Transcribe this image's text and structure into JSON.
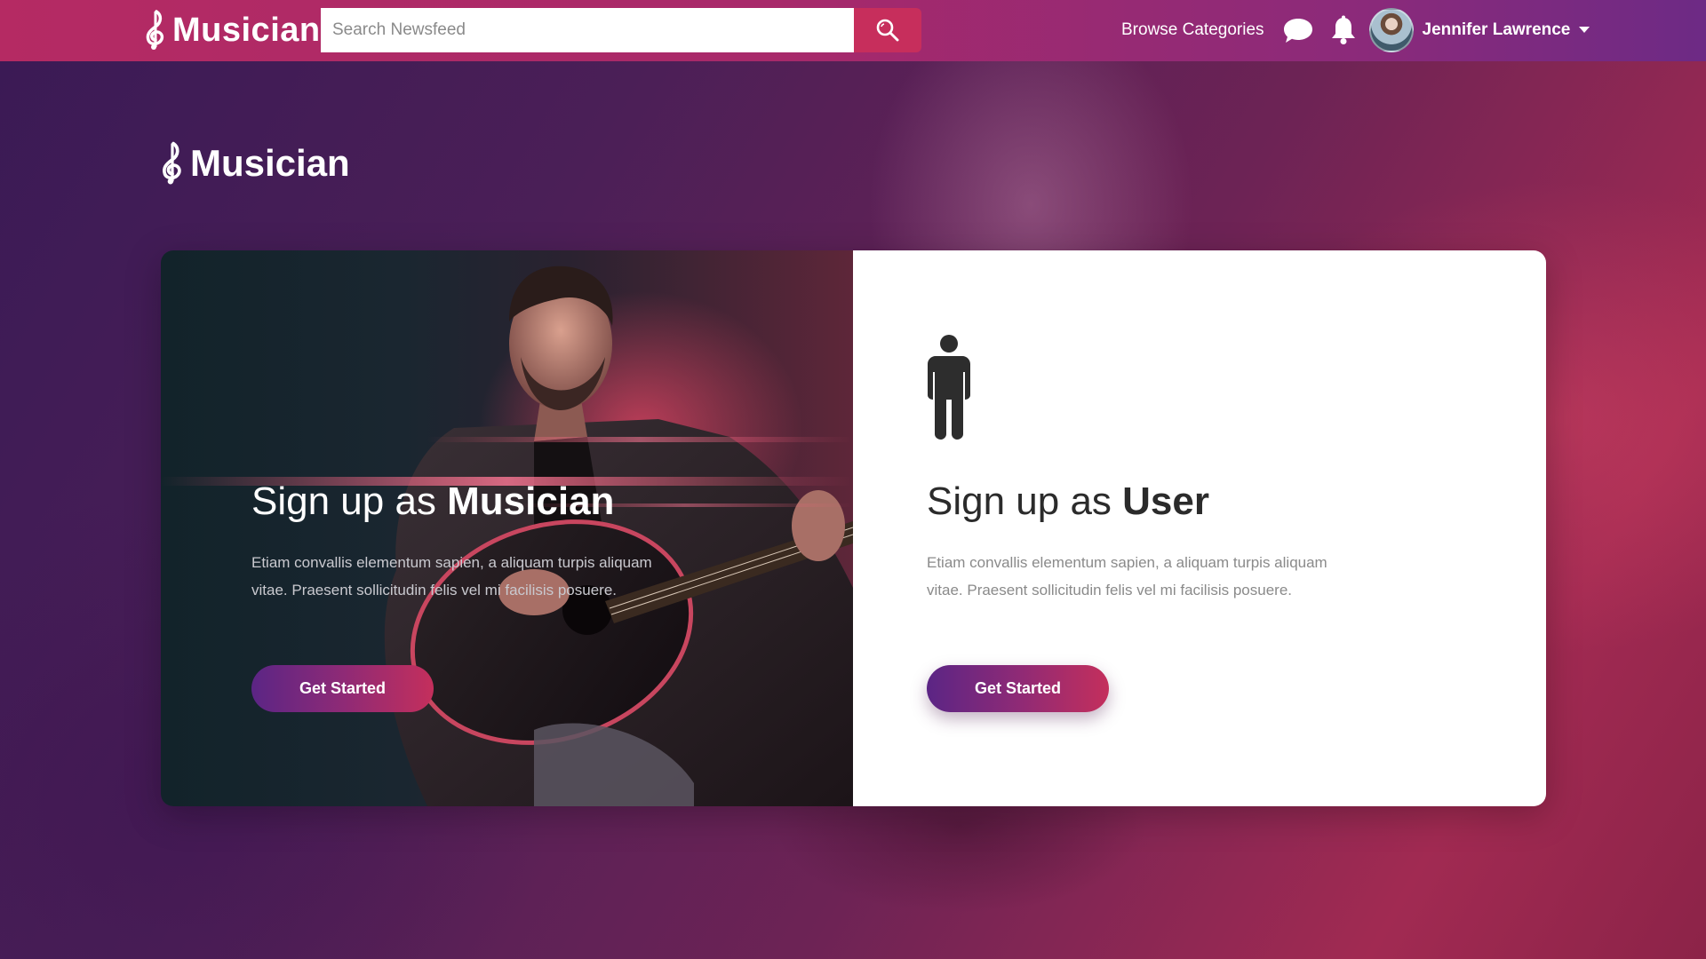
{
  "navbar": {
    "logo_text": "Musician",
    "search": {
      "placeholder": "Search Newsfeed",
      "value": ""
    },
    "browse_label": "Browse Categories",
    "user_name": "Jennifer Lawrence",
    "icons": [
      "chat-bubble-icon",
      "bell-icon",
      "chevron-down-icon",
      "search-icon"
    ]
  },
  "page": {
    "logo_text": "Musician"
  },
  "cards": {
    "musician": {
      "title_prefix": "Sign up as ",
      "title_strong": "Musician",
      "description": "Etiam convallis elementum sapien, a aliquam turpis aliquam vitae. Praesent sollicitudin felis vel mi facilisis posuere.",
      "button_label": "Get Started"
    },
    "user": {
      "title_prefix": "Sign up as ",
      "title_strong": "User",
      "description": "Etiam convallis elementum sapien, a aliquam turpis aliquam vitae. Praesent sollicitudin felis vel mi facilisis posuere.",
      "button_label": "Get Started",
      "icon": "person-icon"
    }
  },
  "colors": {
    "navbar_start": "#b52a63",
    "navbar_end": "#6d2a85",
    "search_button": "#c72e5c",
    "button_gradient_start": "#5b2585",
    "button_gradient_end": "#c42f5c"
  }
}
